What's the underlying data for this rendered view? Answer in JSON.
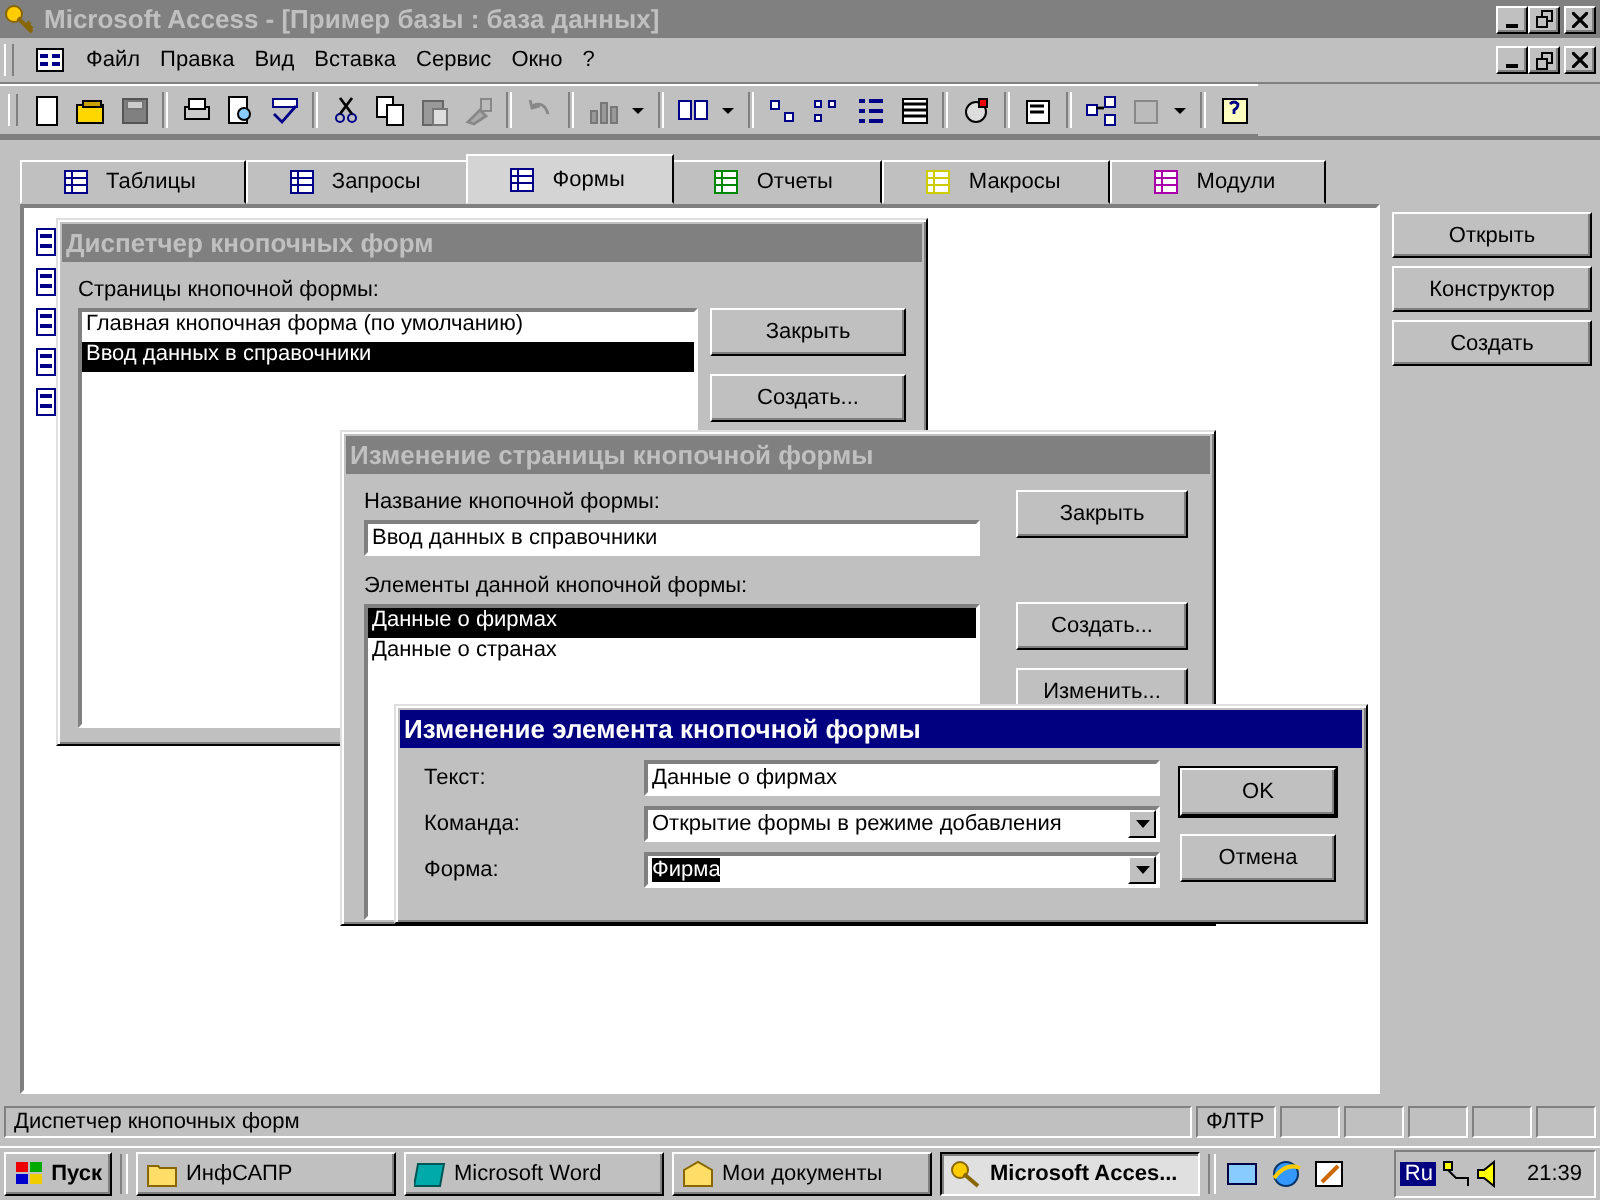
{
  "window": {
    "title": "Microsoft Access - [Пример базы : база данных]",
    "active": false
  },
  "menu": [
    "Файл",
    "Правка",
    "Вид",
    "Вставка",
    "Сервис",
    "Окно",
    "?"
  ],
  "database_window": {
    "tabs": [
      {
        "label": "Таблицы",
        "selected": false
      },
      {
        "label": "Запросы",
        "selected": false
      },
      {
        "label": "Формы",
        "selected": true
      },
      {
        "label": "Отчеты",
        "selected": false
      },
      {
        "label": "Макросы",
        "selected": false
      },
      {
        "label": "Модули",
        "selected": false
      }
    ],
    "buttons": [
      "Открыть",
      "Конструктор",
      "Создать"
    ]
  },
  "switchboard_manager": {
    "title": "Диспетчер кнопочных форм",
    "active": false,
    "list_label": "Страницы кнопочной формы:",
    "list": [
      {
        "text": "Главная кнопочная форма (по умолчанию)",
        "selected": false
      },
      {
        "text": "Ввод данных в справочники",
        "selected": true
      }
    ],
    "buttons": [
      "Закрыть",
      "Создать..."
    ]
  },
  "edit_page_dialog": {
    "title": "Изменение страницы кнопочной формы",
    "active": false,
    "name_label": "Название кнопочной формы:",
    "name_value": "Ввод данных в справочники",
    "list_label": "Элементы данной кнопочной формы:",
    "list": [
      {
        "text": "Данные о фирмах",
        "selected": true
      },
      {
        "text": "Данные о странах",
        "selected": false
      }
    ],
    "buttons": [
      "Закрыть",
      "Создать...",
      "Изменить..."
    ]
  },
  "edit_item_dialog": {
    "title": "Изменение элемента кнопочной формы",
    "active": true,
    "fields": [
      {
        "label": "Текст:",
        "kind": "text",
        "value": "Данные о фирмах",
        "selected": false
      },
      {
        "label": "Команда:",
        "kind": "combo",
        "value": "Открытие формы в режиме добавления",
        "selected": false
      },
      {
        "label": "Форма:",
        "kind": "combo",
        "value": "Фирма",
        "selected": true
      }
    ],
    "buttons": [
      "OK",
      "Отмена"
    ]
  },
  "status_bar": {
    "message": "Диспетчер кнопочных форм",
    "indicators": [
      "ФЛТР"
    ]
  },
  "taskbar": {
    "start": "Пуск",
    "tasks": [
      {
        "label": "ИнфСАПР",
        "selected": false
      },
      {
        "label": "Microsoft Word",
        "selected": false
      },
      {
        "label": "Мои документы",
        "selected": false
      },
      {
        "label": "Microsoft Acces...",
        "selected": true
      }
    ],
    "language": "Ru",
    "time": "21:39"
  }
}
